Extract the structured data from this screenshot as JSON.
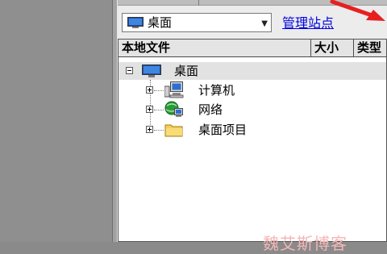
{
  "site_selector": {
    "selected": "桌面",
    "icon": "desktop-monitor-icon"
  },
  "manage_link": "管理站点",
  "file_list": {
    "columns": [
      "本地文件",
      "大小",
      "类型"
    ]
  },
  "tree": {
    "root": {
      "label": "桌面",
      "icon": "desktop-monitor-icon"
    },
    "children": [
      {
        "label": "计算机",
        "icon": "computer-icon"
      },
      {
        "label": "网络",
        "icon": "network-globe-icon"
      },
      {
        "label": "桌面项目",
        "icon": "folder-icon"
      }
    ]
  },
  "watermark": "魏艾斯博客",
  "colors": {
    "link": "#0000e0",
    "annotation_arrow": "#e62020",
    "selected_row": "#e2e2e2"
  }
}
